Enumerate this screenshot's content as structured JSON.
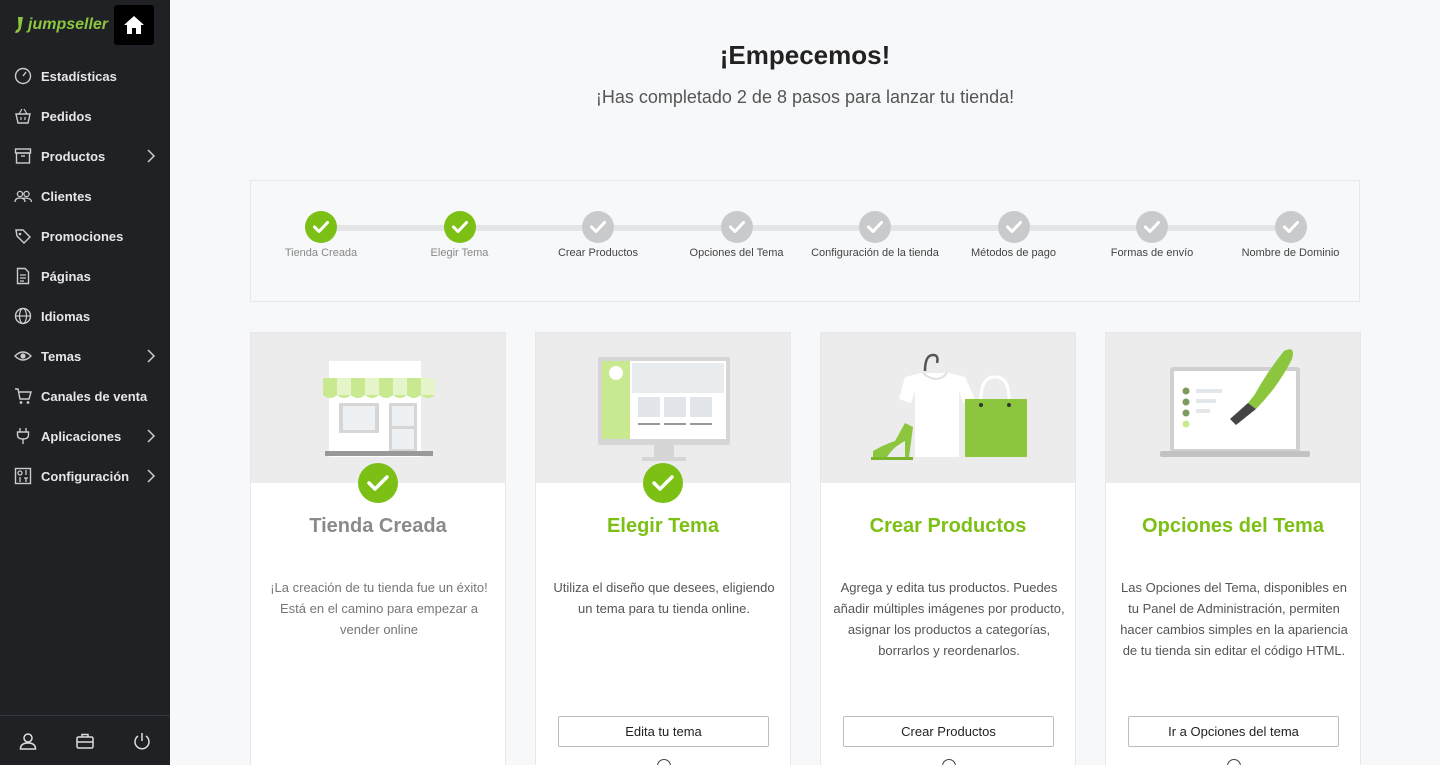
{
  "brand": {
    "name": "jumpseller"
  },
  "sidebar": {
    "items": [
      {
        "label": "Estadísticas",
        "icon": "gauge-icon",
        "chevron": false
      },
      {
        "label": "Pedidos",
        "icon": "basket-icon",
        "chevron": false
      },
      {
        "label": "Productos",
        "icon": "archive-box-icon",
        "chevron": true
      },
      {
        "label": "Clientes",
        "icon": "users-icon",
        "chevron": false
      },
      {
        "label": "Promociones",
        "icon": "tags-icon",
        "chevron": false
      },
      {
        "label": "Páginas",
        "icon": "document-icon",
        "chevron": false
      },
      {
        "label": "Idiomas",
        "icon": "globe-icon",
        "chevron": false
      },
      {
        "label": "Temas",
        "icon": "eye-icon",
        "chevron": true
      },
      {
        "label": "Canales de venta",
        "icon": "cart-icon",
        "chevron": false
      },
      {
        "label": "Aplicaciones",
        "icon": "plug-icon",
        "chevron": true
      },
      {
        "label": "Configuración",
        "icon": "settings-panel-icon",
        "chevron": true
      }
    ],
    "footer": [
      "user-icon",
      "briefcase-icon",
      "power-icon"
    ]
  },
  "header": {
    "title": "¡Empecemos!",
    "subtitle": "¡Has completado 2 de 8 pasos para lanzar tu tienda!"
  },
  "steps": [
    {
      "label": "Tienda Creada",
      "done": true
    },
    {
      "label": "Elegir Tema",
      "done": true
    },
    {
      "label": "Crear Productos",
      "done": false
    },
    {
      "label": "Opciones del Tema",
      "done": false
    },
    {
      "label": "Configuración de la tienda",
      "done": false
    },
    {
      "label": "Métodos de pago",
      "done": false
    },
    {
      "label": "Formas de envío",
      "done": false
    },
    {
      "label": "Nombre de Dominio",
      "done": false
    }
  ],
  "cards": [
    {
      "title": "Tienda Creada",
      "done": true,
      "description": "¡La creación de tu tienda fue un éxito! Está en el camino para empezar a vender online",
      "button": ""
    },
    {
      "title": "Elegir Tema",
      "done": true,
      "description": "Utiliza el diseño que desees, eligiendo un tema para tu tienda online.",
      "button": "Edita tu tema"
    },
    {
      "title": "Crear Productos",
      "done": false,
      "description": "Agrega y edita tus productos. Puedes añadir múltiples imágenes por producto, asignar los productos a categorías, borrarlos y reordenarlos.",
      "button": "Crear Productos"
    },
    {
      "title": "Opciones del Tema",
      "done": false,
      "description": "Las Opciones del Tema, disponibles en tu Panel de Administración, permiten hacer cambios simples en la apariencia de tu tienda sin editar el código HTML.",
      "button": "Ir a Opciones del tema"
    }
  ],
  "colors": {
    "accent": "#7cc016",
    "sidebar": "#1f2124",
    "pending": "#c9cacc"
  }
}
